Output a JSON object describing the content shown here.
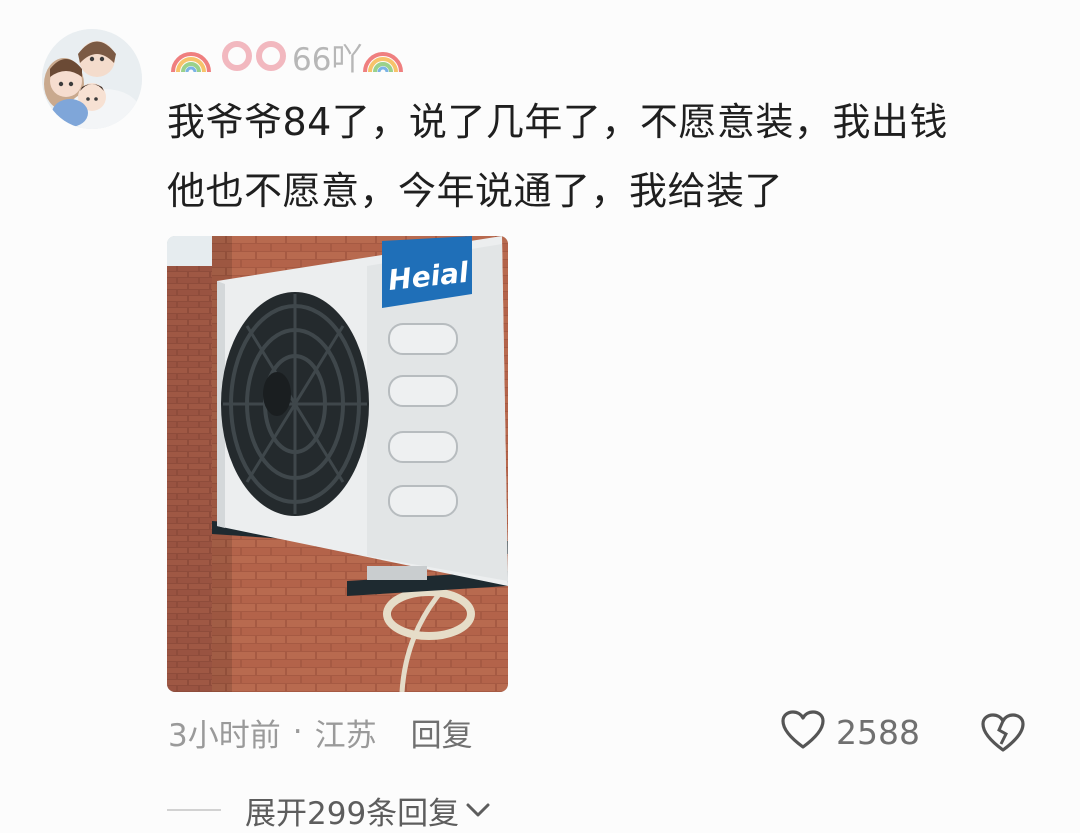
{
  "comment": {
    "username": "66吖",
    "text_lines": [
      "我爷爷84了，说了几年了，不愿意装，我出钱",
      "他也不愿意，今年说通了，我给装了"
    ],
    "image": {
      "brand_label": "Heial"
    },
    "time": "3小时前",
    "separator": "·",
    "location": "江苏",
    "reply_label": "回复",
    "like_count": "2588"
  },
  "expand": {
    "label": "展开299条回复"
  },
  "icons": {
    "username_decor": "rainbow-icon",
    "like": "heart-icon",
    "dislike": "broken-heart-icon",
    "expand": "chevron-down-icon"
  },
  "colors": {
    "text": "#1f1f1f",
    "meta": "#9a9a9a",
    "ring": "#f2b8bf"
  }
}
